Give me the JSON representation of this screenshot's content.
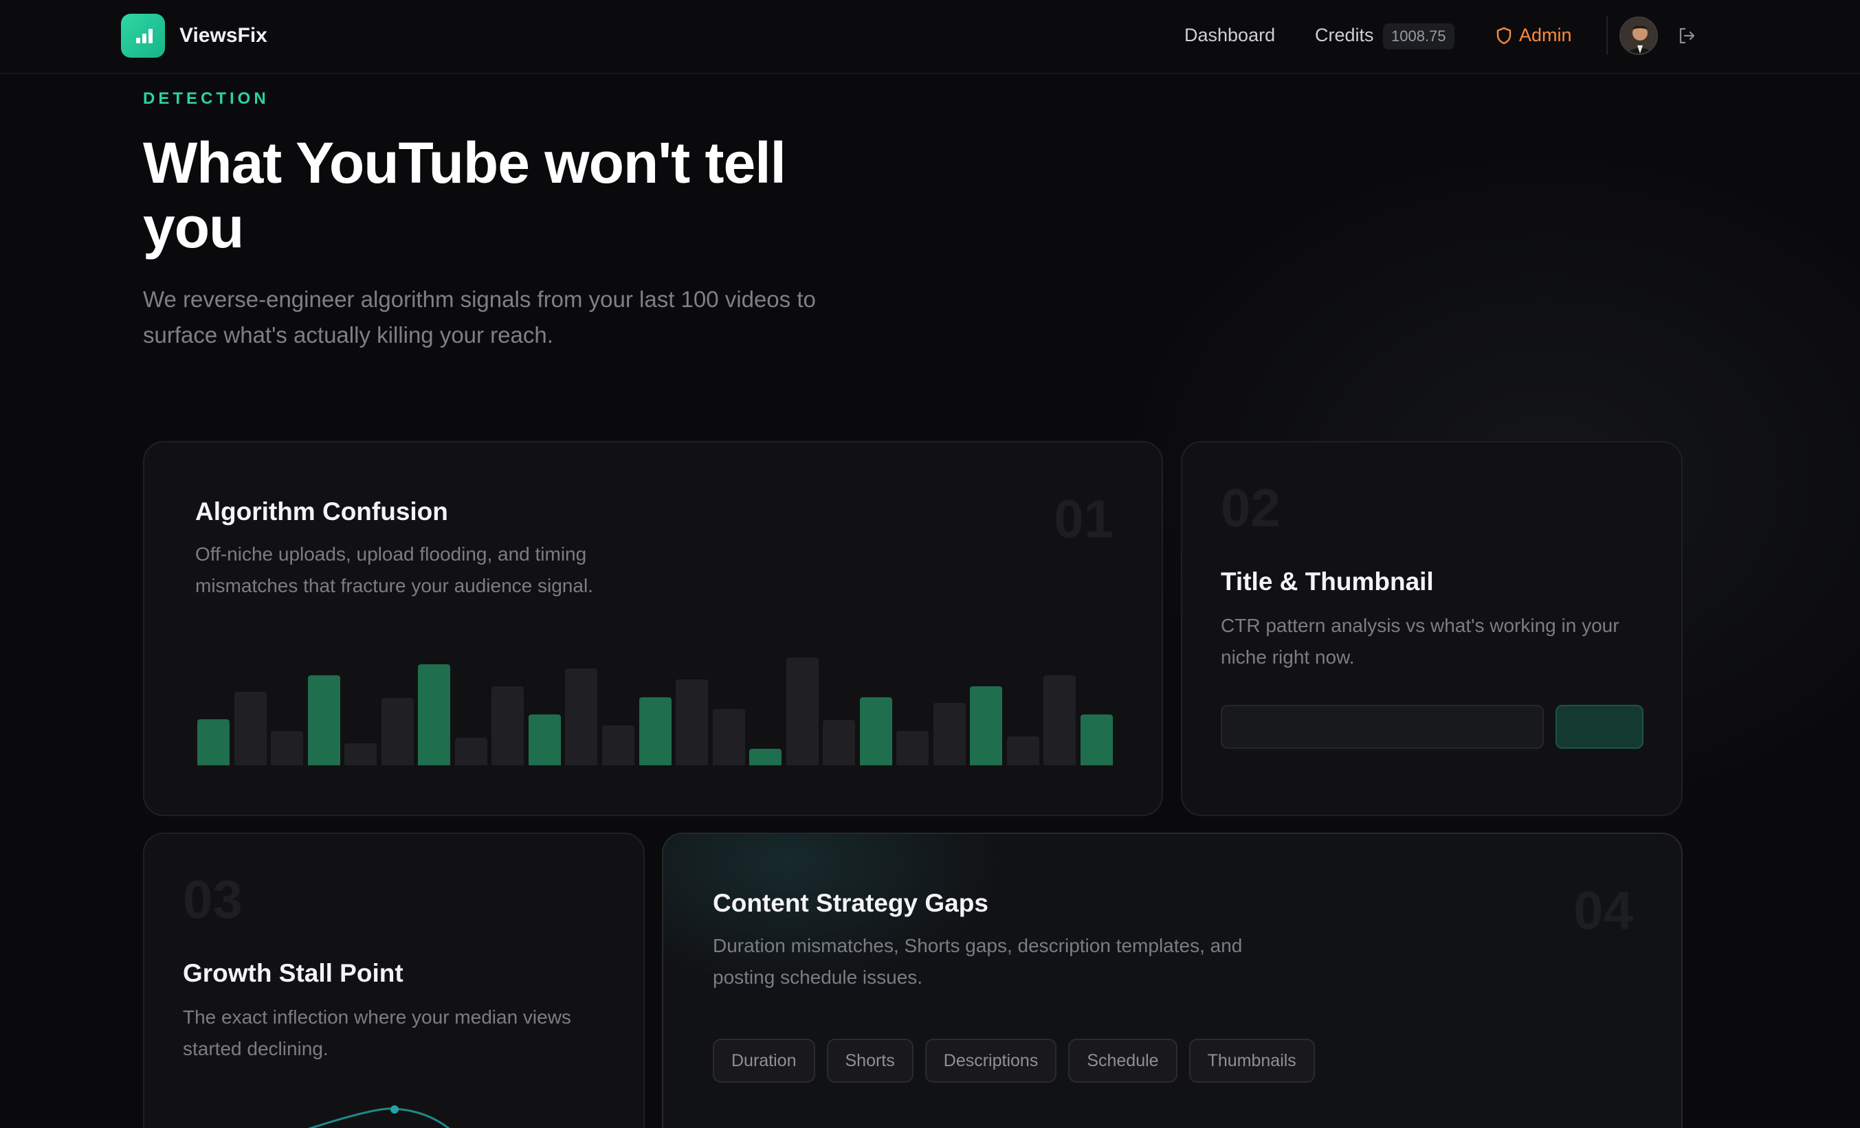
{
  "brand": {
    "name": "ViewsFix",
    "logo_icon": "bar-chart-icon",
    "accent": "#22c99a"
  },
  "nav": {
    "dashboard_label": "Dashboard",
    "credits_label": "Credits",
    "credits_value": "1008.75",
    "admin_label": "Admin",
    "admin_color": "#ff8a3d",
    "admin_icon": "shield-icon",
    "logout_icon": "logout-icon"
  },
  "hero": {
    "eyebrow": "DETECTION",
    "title": "What YouTube won't tell you",
    "subtitle": "We reverse-engineer algorithm signals from your last 100 videos to surface what's actually killing your reach."
  },
  "cards": {
    "algorithm": {
      "number": "01",
      "title": "Algorithm Confusion",
      "description": "Off-niche uploads, upload flooding, and timing mismatches that fracture your audience signal.",
      "bars": [
        0.42,
        0.67,
        0.31,
        0.82,
        0.2,
        0.61,
        0.92,
        0.25,
        0.72,
        0.46,
        0.88,
        0.36,
        0.62,
        0.78,
        0.51,
        0.15,
        0.98,
        0.41,
        0.62,
        0.31,
        0.57,
        0.72,
        0.26,
        0.82,
        0.46
      ],
      "highlighted": [
        0,
        3,
        6,
        9,
        12,
        15,
        18,
        21,
        24
      ]
    },
    "title_thumbnail": {
      "number": "02",
      "title": "Title & Thumbnail",
      "description": "CTR pattern analysis vs what's working in your niche right now."
    },
    "growth": {
      "number": "03",
      "title": "Growth Stall Point",
      "description": "The exact inflection where your median views started declining."
    },
    "content": {
      "number": "04",
      "title": "Content Strategy Gaps",
      "description": "Duration mismatches, Shorts gaps, description templates, and posting schedule issues.",
      "tags": [
        "Duration",
        "Shorts",
        "Descriptions",
        "Schedule",
        "Thumbnails"
      ]
    }
  }
}
